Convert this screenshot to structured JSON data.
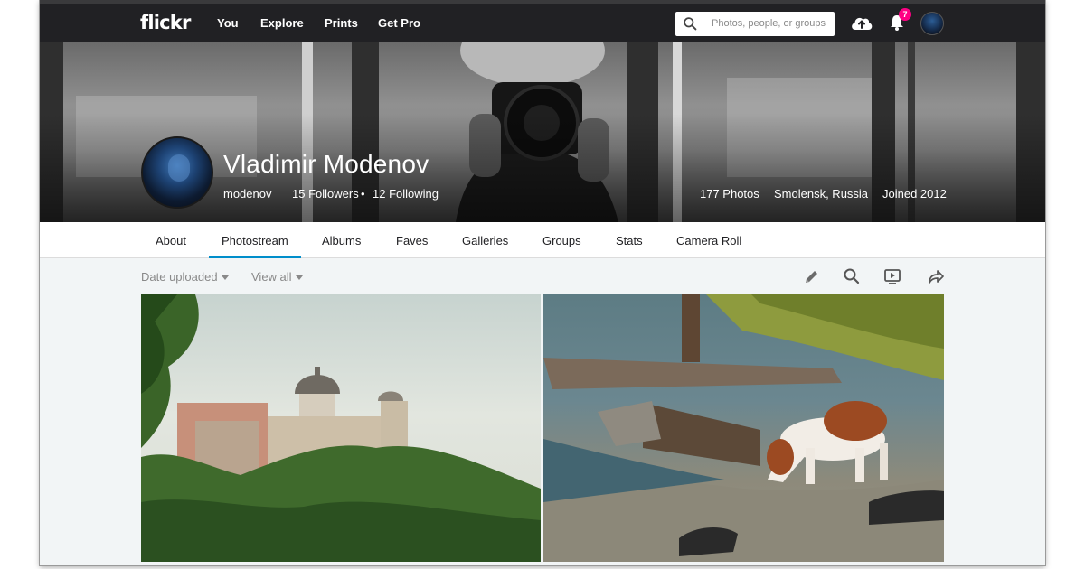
{
  "nav": {
    "logo": "flickr",
    "links": [
      "You",
      "Explore",
      "Prints",
      "Get Pro"
    ],
    "search_placeholder": "Photos, people, or groups",
    "notifications_count": "7",
    "icons": [
      "search-icon",
      "upload-cloud-icon",
      "bell-icon",
      "avatar"
    ]
  },
  "profile": {
    "name": "Vladimir Modenov",
    "username": "modenov",
    "followers": "15 Followers",
    "separator": "•",
    "following": "12 Following",
    "photos": "177 Photos",
    "location": "Smolensk, Russia",
    "joined": "Joined 2012"
  },
  "tabs": {
    "items": [
      "About",
      "Photostream",
      "Albums",
      "Faves",
      "Galleries",
      "Groups",
      "Stats",
      "Camera Roll"
    ],
    "active": "Photostream",
    "accent_color": "#008ecb"
  },
  "toolbar": {
    "sort_label": "Date uploaded",
    "view_label": "View all",
    "icons": [
      "edit-pencil-icon",
      "search-icon",
      "slideshow-icon",
      "share-icon"
    ]
  },
  "photos": [
    {
      "subject": "hilltop-town-with-domed-church"
    },
    {
      "subject": "dog-drinking-by-lake-shore"
    }
  ],
  "colors": {
    "topbar": "#212124",
    "badge": "#ff0084",
    "page_bg": "#f2f5f6"
  }
}
